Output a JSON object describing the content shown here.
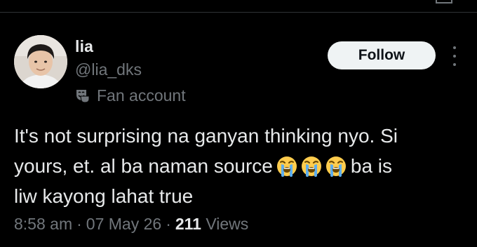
{
  "author": {
    "display_name": "lia",
    "handle": "@lia_dks",
    "affiliation": "Fan account",
    "affiliation_icon": "theater-masks-icon",
    "avatar": "profile-photo"
  },
  "actions": {
    "follow_label": "Follow",
    "more_icon": "vertical-ellipsis-icon"
  },
  "tweet": {
    "line1": "It's not surprising na ganyan thinking nyo. Si",
    "line2_before": "yours, et. al ba naman source",
    "line2_emojis": [
      "loudly-crying-face-emoji",
      "loudly-crying-face-emoji",
      "loudly-crying-face-emoji"
    ],
    "line2_after": "ba is",
    "line3": "liw kayong lahat true"
  },
  "meta": {
    "time": "8:58 am",
    "separator": "·",
    "date": "07 May 26",
    "views_count": "211",
    "views_label": "Views"
  },
  "colors": {
    "background": "#000000",
    "text_primary": "#e7e9ea",
    "text_secondary": "#71767b",
    "button_bg": "#eff3f4",
    "button_text": "#0f1419",
    "divider": "#2f3336"
  }
}
